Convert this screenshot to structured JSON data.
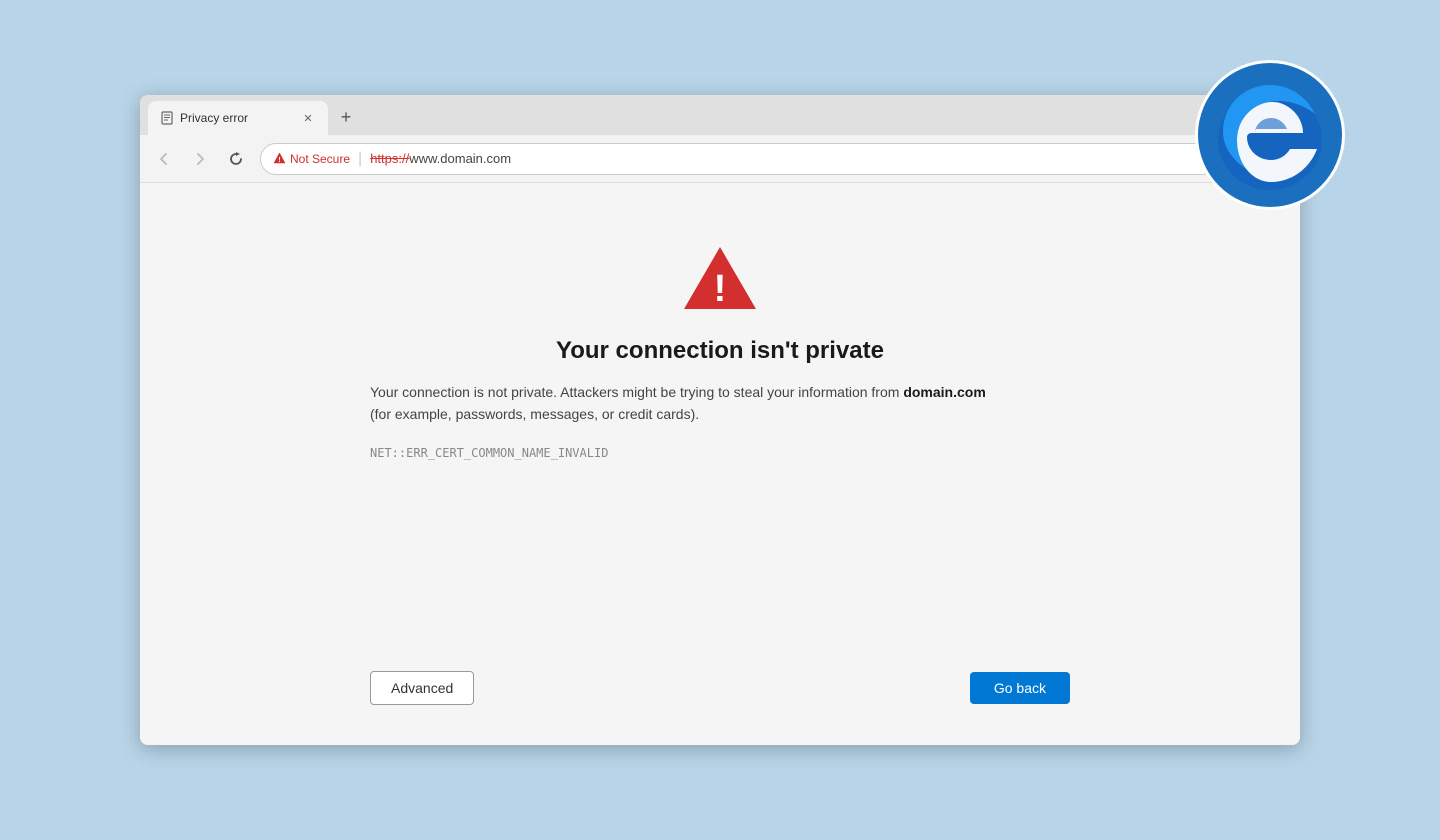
{
  "browser": {
    "tab": {
      "title": "Privacy error",
      "icon": "document"
    },
    "toolbar": {
      "back_disabled": true,
      "forward_disabled": true,
      "security_label": "Not Secure",
      "url_https": "https://",
      "url_rest": "www.domain.com"
    }
  },
  "page": {
    "title": "Your connection isn't private",
    "description_prefix": "Your connection is not private. Attackers might be trying to steal your information from ",
    "domain_bold": "domain.com",
    "description_suffix": "\n(for example, passwords, messages, or credit cards).",
    "error_code": "NET::ERR_CERT_COMMON_NAME_INVALID",
    "buttons": {
      "advanced_label": "Advanced",
      "goback_label": "Go back"
    }
  }
}
